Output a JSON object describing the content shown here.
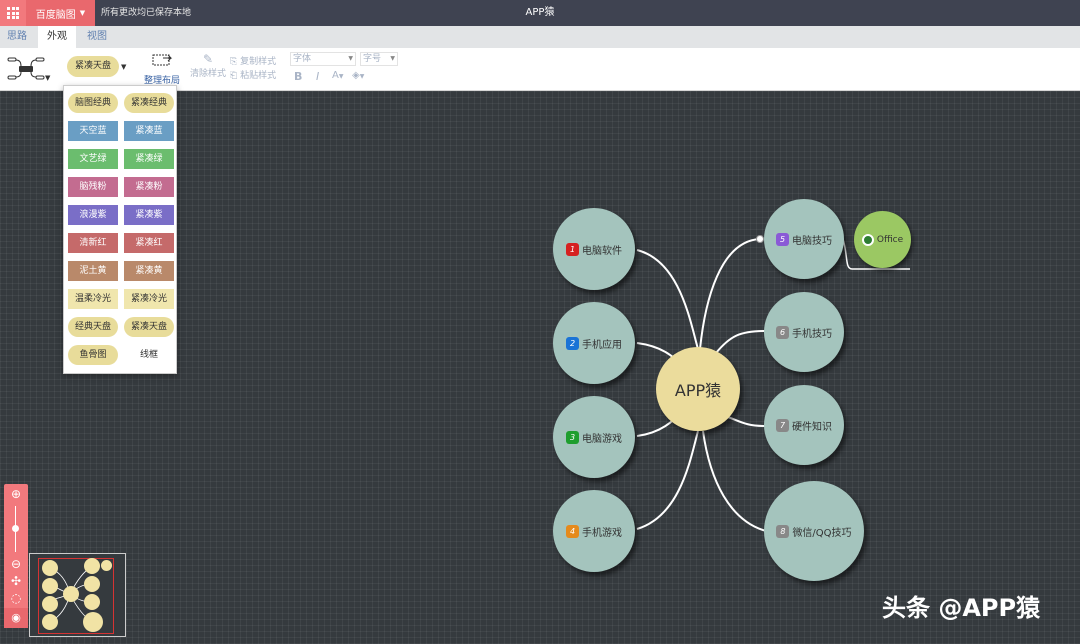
{
  "titlebar": {
    "app_name": "百度脑图",
    "save_status": "所有更改均已保存本地",
    "doc_title": "APP猿"
  },
  "tabs": [
    {
      "label": "思路",
      "active": false
    },
    {
      "label": "外观",
      "active": true
    },
    {
      "label": "视图",
      "active": false
    }
  ],
  "toolbar": {
    "current_theme": "紧凑天盘",
    "layout_label": "整理布局",
    "clear_style": "清除样式",
    "copy_style": "复制样式",
    "paste_style": "粘贴样式",
    "font_placeholder": "字体",
    "size_placeholder": "字号",
    "bold": "B",
    "italic": "I",
    "font_color": "A",
    "bg_color": "◈"
  },
  "theme_menu": [
    {
      "label": "脑图经典",
      "color": "#e8dc9a",
      "text": "#333333",
      "round": true
    },
    {
      "label": "紧凑经典",
      "color": "#e8dc9a",
      "text": "#333333",
      "round": true
    },
    {
      "label": "天空蓝",
      "color": "#6a9ec4",
      "text": "#ffffff",
      "round": false
    },
    {
      "label": "紧凑蓝",
      "color": "#6a9ec4",
      "text": "#ffffff",
      "round": false
    },
    {
      "label": "文艺绿",
      "color": "#6bbd6e",
      "text": "#ffffff",
      "round": false
    },
    {
      "label": "紧凑绿",
      "color": "#6bbd6e",
      "text": "#ffffff",
      "round": false
    },
    {
      "label": "脑残粉",
      "color": "#c36c90",
      "text": "#ffffff",
      "round": false
    },
    {
      "label": "紧凑粉",
      "color": "#c36c90",
      "text": "#ffffff",
      "round": false
    },
    {
      "label": "浪漫紫",
      "color": "#7a6ec7",
      "text": "#ffffff",
      "round": false
    },
    {
      "label": "紧凑紫",
      "color": "#7a6ec7",
      "text": "#ffffff",
      "round": false
    },
    {
      "label": "清新红",
      "color": "#c56a6a",
      "text": "#ffffff",
      "round": false
    },
    {
      "label": "紧凑红",
      "color": "#c56a6a",
      "text": "#ffffff",
      "round": false
    },
    {
      "label": "泥土黄",
      "color": "#b9896a",
      "text": "#ffffff",
      "round": false
    },
    {
      "label": "紧凑黄",
      "color": "#b9896a",
      "text": "#ffffff",
      "round": false
    },
    {
      "label": "温柔冷光",
      "color": "#f0e6ad",
      "text": "#333333",
      "round": false
    },
    {
      "label": "紧凑冷光",
      "color": "#f0e6ad",
      "text": "#333333",
      "round": false
    },
    {
      "label": "经典天盘",
      "color": "#e8dc9a",
      "text": "#333333",
      "round": true
    },
    {
      "label": "紧凑天盘",
      "color": "#e8dc9a",
      "text": "#333333",
      "round": true
    },
    {
      "label": "鱼骨图",
      "color": "#e8dc9a",
      "text": "#333333",
      "round": true
    },
    {
      "label": "线框",
      "color": "#ffffff",
      "text": "#333333",
      "round": false
    }
  ],
  "mindmap": {
    "root": "APP猿",
    "branches": [
      {
        "num": "1",
        "label": "电脑软件",
        "badge_color": "#d62020"
      },
      {
        "num": "2",
        "label": "手机应用",
        "badge_color": "#1a73d6"
      },
      {
        "num": "3",
        "label": "电脑游戏",
        "badge_color": "#1e9e2e"
      },
      {
        "num": "4",
        "label": "手机游戏",
        "badge_color": "#e58a1c"
      },
      {
        "num": "5",
        "label": "电脑技巧",
        "badge_color": "#8a5ad6"
      },
      {
        "num": "6",
        "label": "手机技巧",
        "badge_color": "#888888"
      },
      {
        "num": "7",
        "label": "硬件知识",
        "badge_color": "#888888"
      },
      {
        "num": "8",
        "label": "微信/QQ技巧",
        "badge_color": "#888888"
      }
    ],
    "sub_node": "Office"
  },
  "watermark": "头条 @APP猿"
}
